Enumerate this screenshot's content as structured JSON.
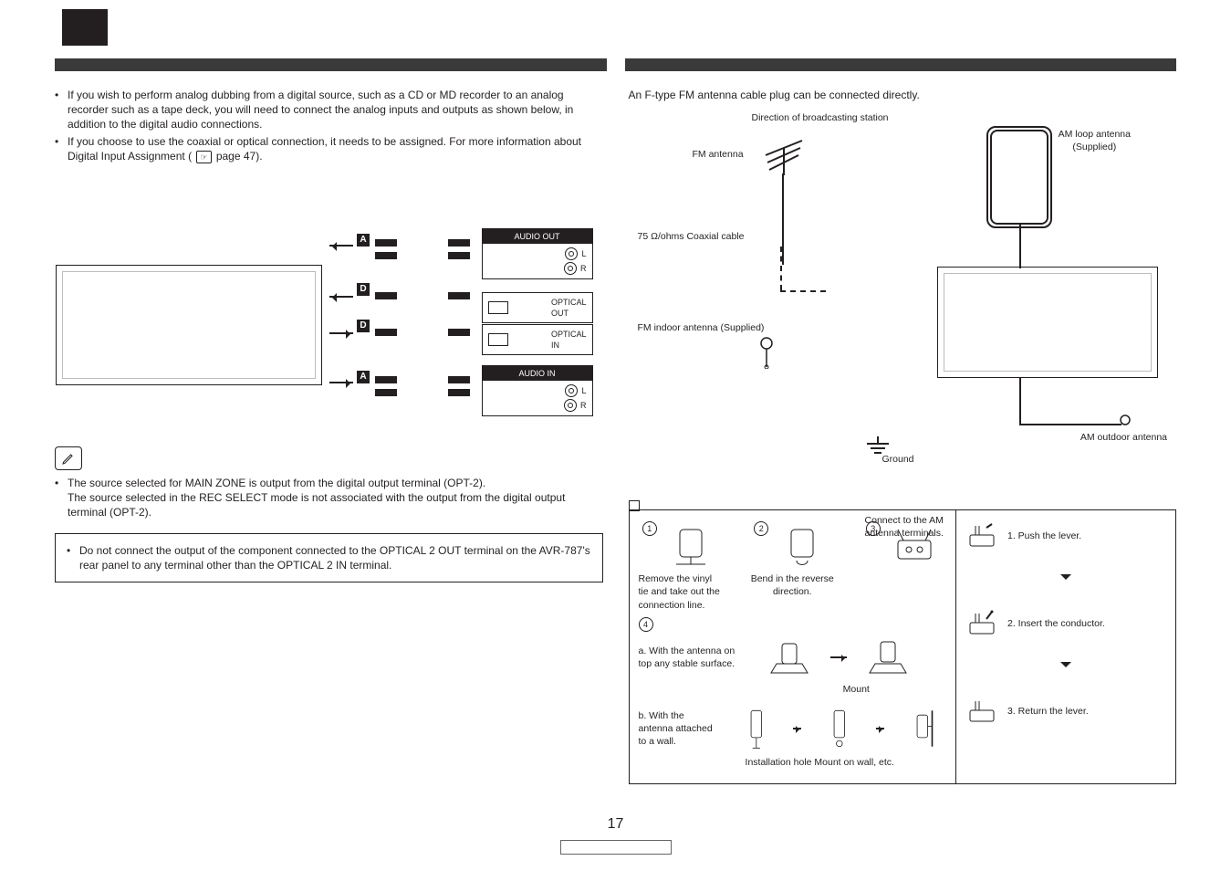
{
  "page_number": "17",
  "left": {
    "bullets": [
      "If you wish to perform analog dubbing from a digital source, such as a CD or MD recorder to an analog recorder such as a tape deck, you will need to connect the analog inputs and outputs as shown below, in addition to the digital audio connections.",
      "If you choose to use the coaxial or optical connection, it needs to be assigned. For more information about Digital Input Assignment ("
    ],
    "page_ref": " page 47).",
    "diagram": {
      "tags": {
        "A": "A",
        "D": "D"
      },
      "ports": {
        "audio_out": "AUDIO OUT",
        "optical_out_t": "OPTICAL",
        "optical_out_b": "OUT",
        "optical_in_t": "OPTICAL",
        "optical_in_b": "IN",
        "audio_in": "AUDIO IN",
        "L": "L",
        "R": "R"
      }
    },
    "pencil_notes": [
      "The source selected for MAIN ZONE is output from the digital output terminal (OPT-2).",
      "The source selected in the REC SELECT mode is not associated with the output from the digital output terminal (OPT-2)."
    ],
    "warning": "Do not connect the output of the component connected to the OPTICAL 2 OUT terminal on the AVR-787's rear panel to any terminal other than the OPTICAL 2 IN terminal."
  },
  "right": {
    "intro": "An F-type FM antenna cable plug can be connected directly.",
    "labels": {
      "direction": "Direction of broadcasting station",
      "fm_antenna": "FM antenna",
      "am_loop": "AM loop antenna",
      "supplied": "(Supplied)",
      "coax": "75 Ω/ohms Coaxial cable",
      "fm_indoor": "FM indoor antenna (Supplied)",
      "am_outdoor": "AM outdoor antenna",
      "ground": "Ground"
    },
    "assembly": {
      "title_square": "❏",
      "step1_text": "Remove the vinyl tie and take out the connection line.",
      "step2_text": "Bend in the reverse direction.",
      "step3_text": "Connect to the AM antenna terminals.",
      "a_text": "a. With the antenna on top any stable surface.",
      "mount": "Mount",
      "b_text": "b. With the antenna attached to a wall.",
      "install": "Installation hole Mount on wall, etc.",
      "right_steps": {
        "s1": "1. Push the lever.",
        "s2": "2. Insert the conductor.",
        "s3": "3. Return the lever."
      }
    }
  }
}
